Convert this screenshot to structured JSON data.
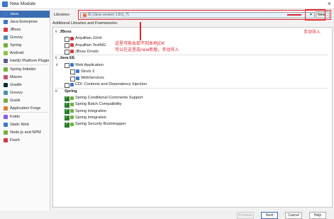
{
  "window": {
    "title": "New Module"
  },
  "sidebar": {
    "items": [
      {
        "label": "Java",
        "color": "#3c78c8"
      },
      {
        "label": "Java Enterprise",
        "color": "#3c78c8"
      },
      {
        "label": "JBoss",
        "color": "#d23c3c"
      },
      {
        "label": "Groovy",
        "color": "#4a90b8"
      },
      {
        "label": "Spring",
        "color": "#6cb33e"
      },
      {
        "label": "Android",
        "color": "#8cc34a"
      },
      {
        "label": "IntelliJ Platform Plugin",
        "color": "#5a5aa0"
      },
      {
        "label": "Spring Initializr",
        "color": "#6cb33e"
      },
      {
        "label": "Maven",
        "color": "#c85078"
      },
      {
        "label": "Gradle",
        "color": "#02303a"
      },
      {
        "label": "Groovy",
        "color": "#4a90b8"
      },
      {
        "label": "Grails",
        "color": "#6cb33e"
      },
      {
        "label": "Application Forge",
        "color": "#e08030"
      },
      {
        "label": "Kotlin",
        "color": "#8a5cf0"
      },
      {
        "label": "Static Web",
        "color": "#3c78c8"
      },
      {
        "label": "Node.js and NPM",
        "color": "#6cb33e"
      },
      {
        "label": "Flash",
        "color": "#d23c3c"
      }
    ]
  },
  "library": {
    "label": "Libraries:",
    "value": "IE (Java version 1.8.0_?)",
    "new_button": "New..."
  },
  "section_label": "Additional Libraries and Frameworks:",
  "tree": [
    {
      "type": "cat",
      "label": "JBoss"
    },
    {
      "type": "item",
      "label": "Arquillian JUnit",
      "checked": false,
      "indent": 1,
      "color": "#d23c3c"
    },
    {
      "type": "item",
      "label": "Arquillian TestNG",
      "checked": false,
      "indent": 1,
      "color": "#d23c3c"
    },
    {
      "type": "item",
      "label": "JBoss Drools",
      "checked": false,
      "indent": 1,
      "color": "#d23c3c"
    },
    {
      "type": "cat",
      "label": "Java EE"
    },
    {
      "type": "item",
      "label": "Web Application",
      "checked": false,
      "indent": 1,
      "toggle": "∨",
      "color": "#3c78c8"
    },
    {
      "type": "item",
      "label": "Struts 2",
      "checked": false,
      "indent": 2,
      "color": "#3c78c8"
    },
    {
      "type": "item",
      "label": "WebServices",
      "checked": false,
      "indent": 2,
      "color": "#3c78c8"
    },
    {
      "type": "item",
      "label": "CDI: Contexts and Dependency Injection",
      "checked": false,
      "indent": 1,
      "color": "#3c78c8"
    },
    {
      "type": "cat",
      "label": "Spring",
      "checked": true
    },
    {
      "type": "item",
      "label": "Spring Conditional Comments Support",
      "checked": true,
      "indent": 1,
      "color": "#6cb33e"
    },
    {
      "type": "item",
      "label": "Spring Batch Compatibility",
      "checked": true,
      "indent": 1,
      "color": "#6cb33e"
    },
    {
      "type": "item",
      "label": "Spring Integration",
      "checked": true,
      "indent": 1,
      "color": "#6cb33e"
    },
    {
      "type": "item",
      "label": "Spring Integration",
      "checked": true,
      "indent": 1,
      "color": "#6cb33e"
    },
    {
      "type": "item",
      "label": "Spring Security Bootstrapper",
      "checked": true,
      "indent": 1,
      "color": "#6cb33e"
    }
  ],
  "annotations": {
    "note_line1": "这里可能出现不到本地JDK",
    "note_line2": "可以在这里选new新版，手动导入",
    "manual_import": "手动导入"
  },
  "footer": {
    "previous": "Previous",
    "next": "Next",
    "cancel": "Cancel",
    "help": "Help"
  }
}
